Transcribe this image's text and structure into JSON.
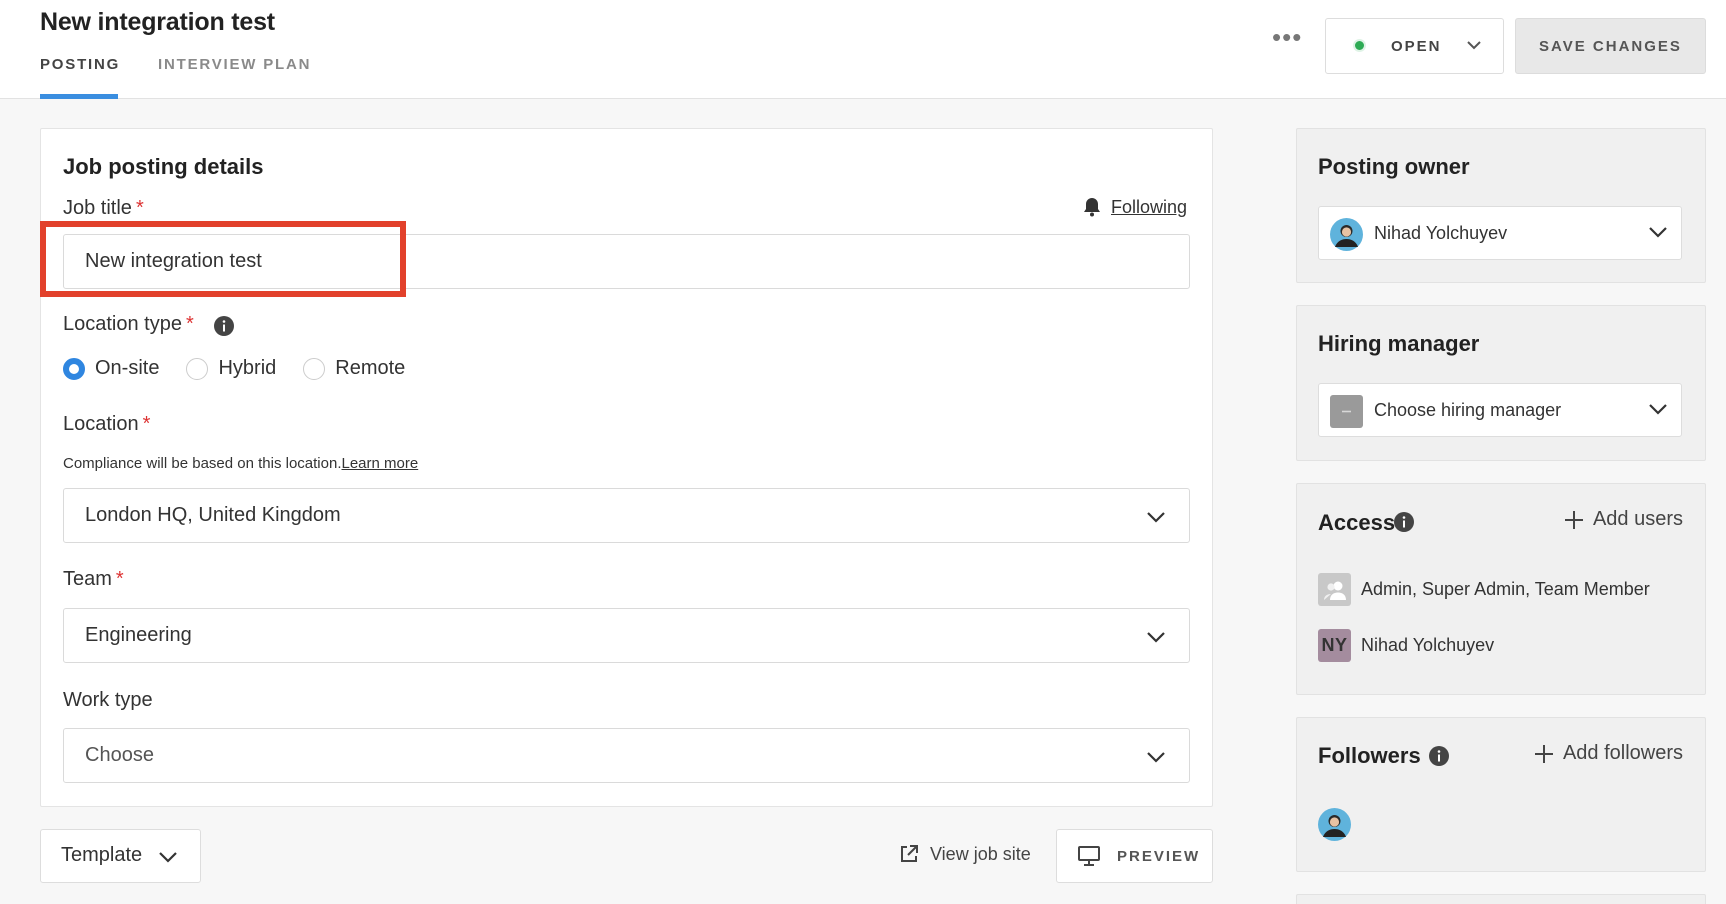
{
  "header": {
    "title": "New integration test",
    "tabs": [
      {
        "label": "POSTING",
        "active": true
      },
      {
        "label": "INTERVIEW PLAN",
        "active": false
      }
    ],
    "more_label": "•••",
    "status_label": "OPEN",
    "status_color": "#2eab55",
    "save_label": "SAVE CHANGES"
  },
  "form": {
    "section_title": "Job posting details",
    "job_title": {
      "label": "Job title",
      "required": "*",
      "value": "New integration test",
      "follow_label": "Following"
    },
    "location_type": {
      "label": "Location type",
      "required": "*",
      "options": [
        "On-site",
        "Hybrid",
        "Remote"
      ],
      "selected": "On-site"
    },
    "location": {
      "label": "Location",
      "required": "*",
      "hint": "Compliance will be based on this location.",
      "hint_link": "Learn more",
      "value": "London HQ, United Kingdom"
    },
    "team": {
      "label": "Team",
      "required": "*",
      "value": "Engineering"
    },
    "work_type": {
      "label": "Work type",
      "value": "Choose"
    }
  },
  "footer": {
    "template_label": "Template",
    "view_site_label": "View job site",
    "preview_label": "PREVIEW"
  },
  "sidebar": {
    "posting_owner": {
      "title": "Posting owner",
      "value": "Nihad Yolchuyev"
    },
    "hiring_manager": {
      "title": "Hiring manager",
      "placeholder": "Choose hiring manager"
    },
    "access": {
      "title": "Access",
      "add_label": "Add users",
      "rows": [
        {
          "avatar": "group-icon",
          "text": "Admin, Super Admin, Team Member"
        },
        {
          "avatar": "NY",
          "text": "Nihad Yolchuyev"
        }
      ]
    },
    "followers": {
      "title": "Followers",
      "add_label": "Add followers"
    }
  },
  "colors": {
    "accent": "#2f86e0",
    "highlight": "#e2412b",
    "required": "#d33333"
  }
}
